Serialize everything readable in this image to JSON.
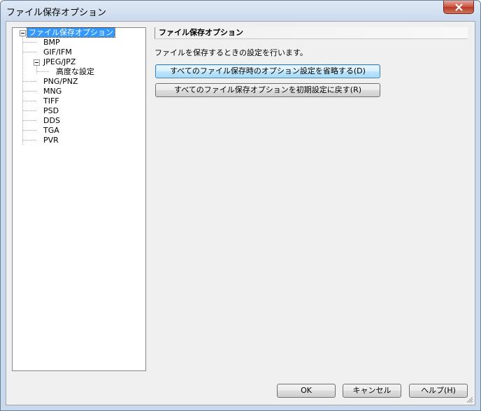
{
  "window": {
    "title": "ファイル保存オプション",
    "close_icon": "close-icon"
  },
  "tree": {
    "root": "ファイル保存オプション",
    "items": [
      "BMP",
      "GIF/IFM",
      "JPEG/JPZ",
      "高度な設定",
      "PNG/PNZ",
      "MNG",
      "TIFF",
      "PSD",
      "DDS",
      "TGA",
      "PVR"
    ]
  },
  "panel": {
    "title": "ファイル保存オプション",
    "description": "ファイルを保存するときの設定を行います。",
    "skip_button": "すべてのファイル保存時のオプション設定を省略する(D)",
    "reset_button": "すべてのファイル保存オプションを初期設定に戻す(R)"
  },
  "footer": {
    "ok": "OK",
    "cancel": "キャンセル",
    "help": "ヘルプ(H)"
  },
  "colors": {
    "selection": "#3399ff",
    "frame": "#c9d9ec",
    "close_button": "#c9503d"
  }
}
